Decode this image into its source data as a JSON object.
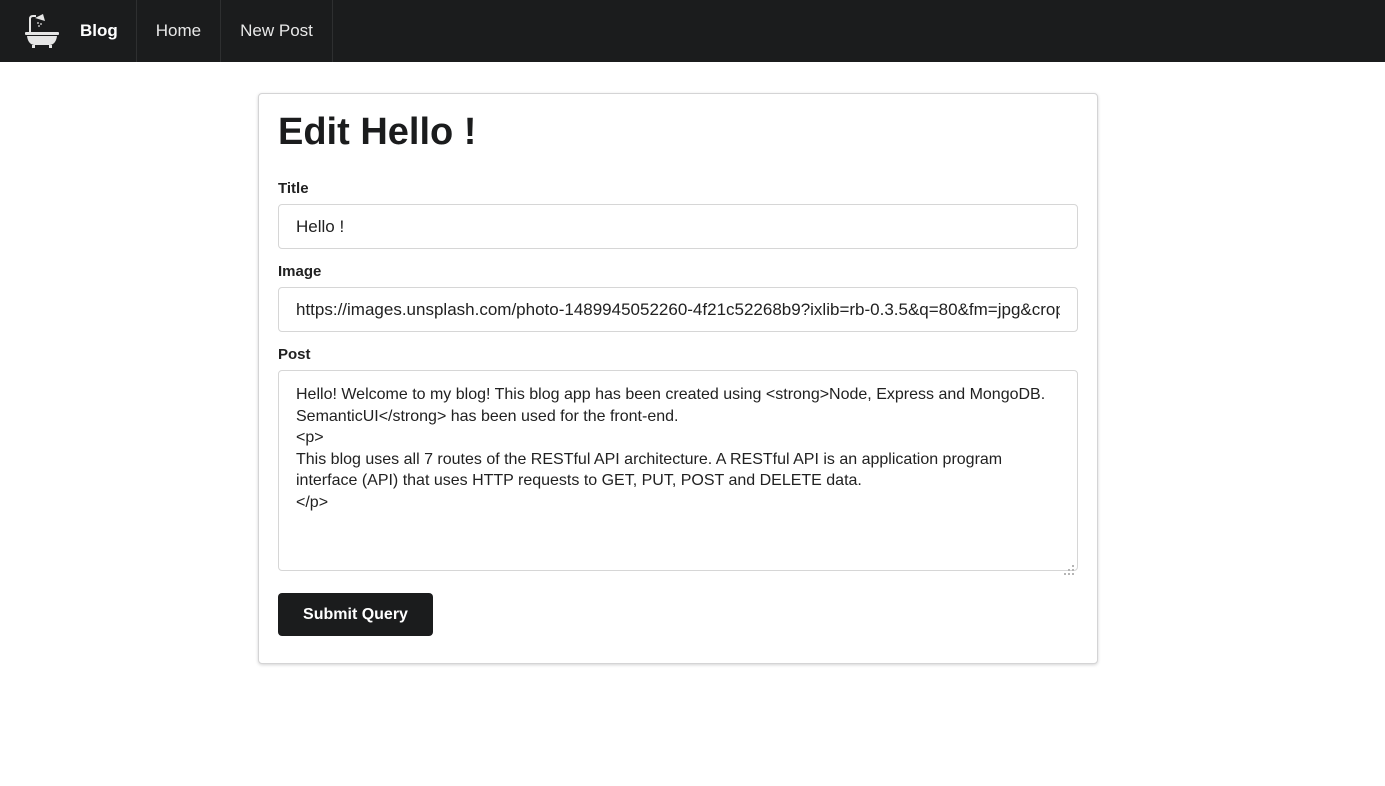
{
  "navbar": {
    "logo_icon": "bathtub-icon",
    "brand_label": "Blog",
    "items": [
      {
        "label": "Home"
      },
      {
        "label": "New Post"
      }
    ],
    "background": "#1b1c1d"
  },
  "form": {
    "heading": "Edit Hello !",
    "title_label": "Title",
    "title_value": "Hello !",
    "image_label": "Image",
    "image_value": "https://images.unsplash.com/photo-1489945052260-4f21c52268b9?ixlib=rb-0.3.5&q=80&fm=jpg&crop",
    "post_label": "Post",
    "post_value": "Hello! Welcome to my blog! This blog app has been created using <strong>Node, Express and MongoDB. SemanticUI</strong> has been used for the front-end.\n<p>\nThis blog uses all 7 routes of the RESTful API architecture. A RESTful API is an application program interface (API) that uses HTTP requests to GET, PUT, POST and DELETE data.\n</p>",
    "submit_label": "Submit Query"
  }
}
